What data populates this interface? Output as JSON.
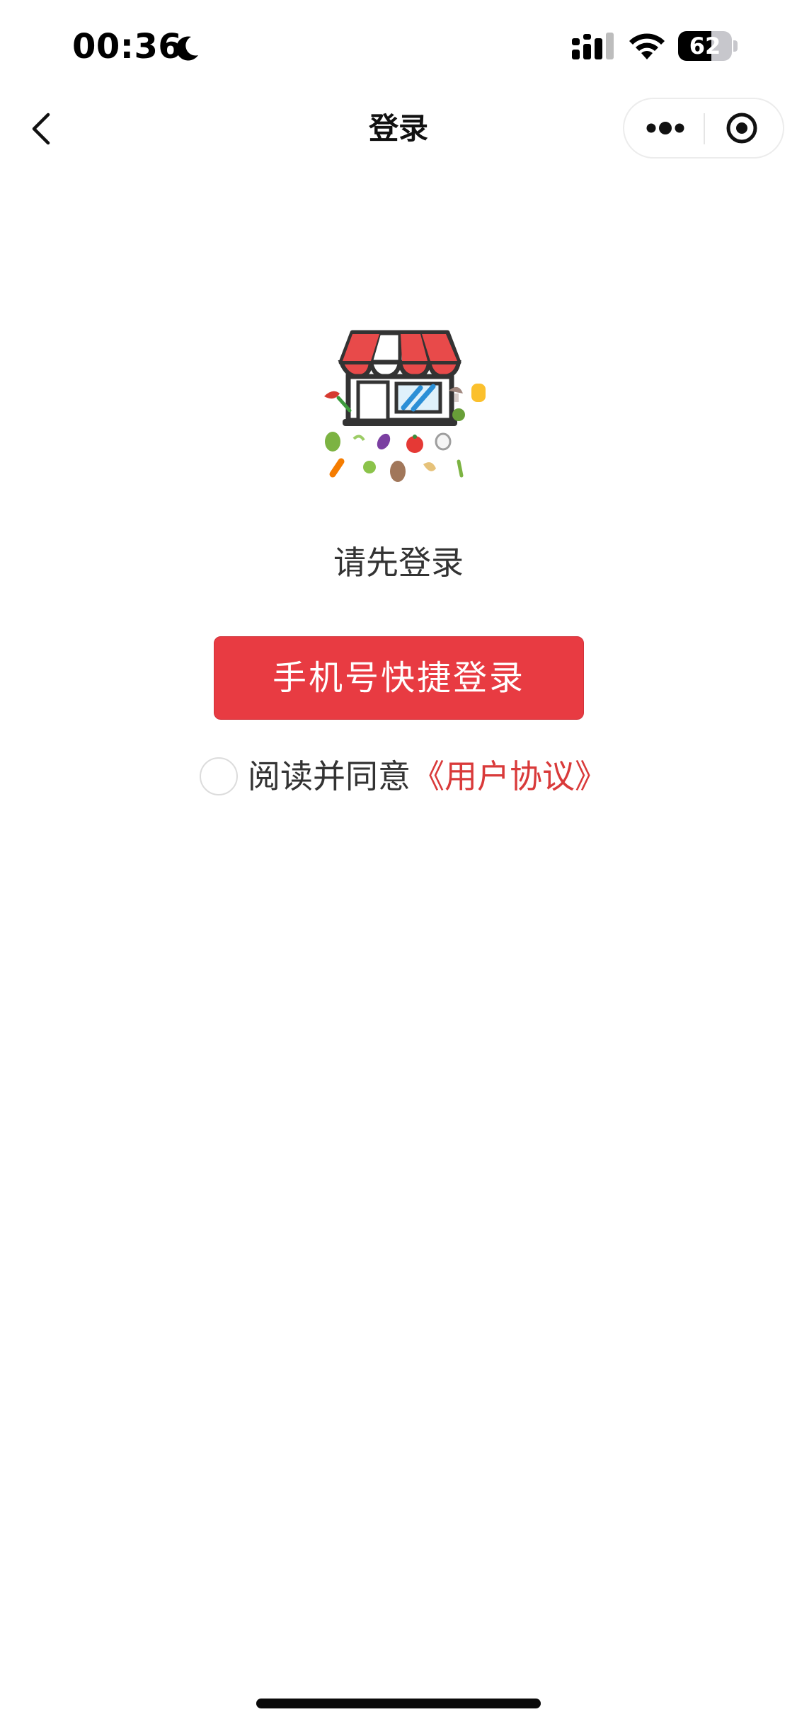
{
  "status_bar": {
    "time": "00:36",
    "battery_percent": "62",
    "battery_level": 0.62,
    "icons": [
      "moon-icon",
      "signal-icon",
      "wifi-icon",
      "battery-icon"
    ]
  },
  "nav": {
    "title": "登录",
    "back_icon": "chevron-left-icon",
    "more_icon": "more-dots-icon",
    "close_icon": "target-close-icon"
  },
  "main": {
    "logo_icon": "storefront-vegetables-icon",
    "prompt": "请先登录",
    "login_button_label": "手机号快捷登录",
    "agreement_prefix": "阅读并同意",
    "agreement_link": "《用户协议》",
    "agreement_checked": false
  },
  "colors": {
    "accent": "#e83b42",
    "link": "#d93a3a",
    "text": "#333333",
    "background": "#ffffff"
  }
}
